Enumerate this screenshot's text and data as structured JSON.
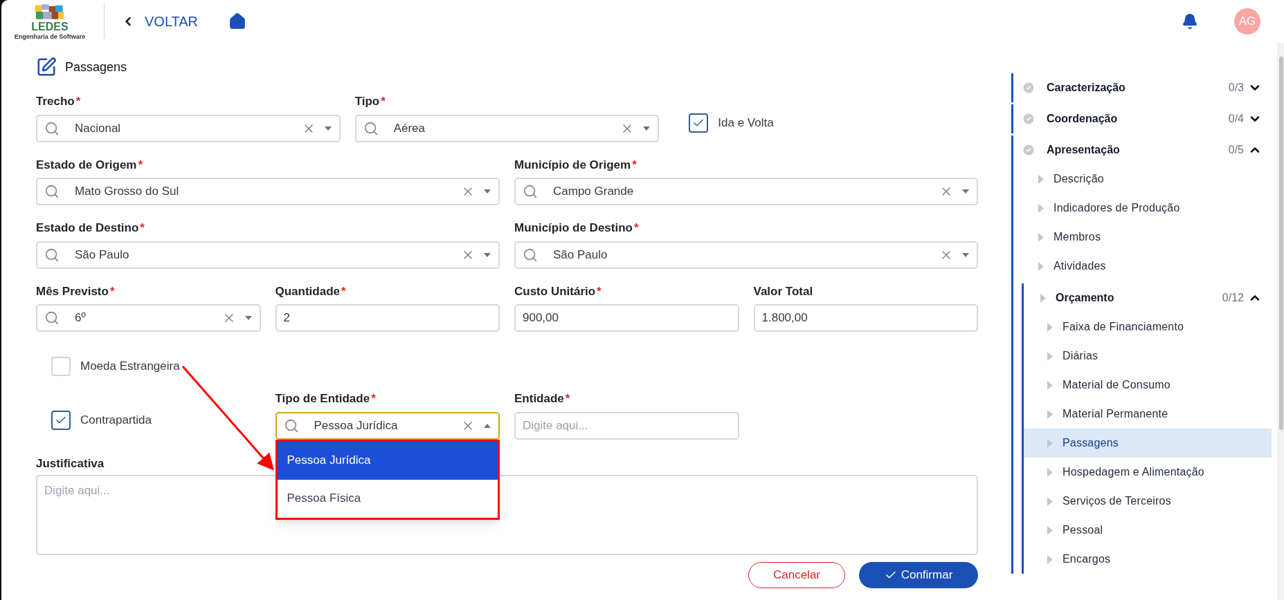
{
  "header": {
    "logo": {
      "title": "LEDES",
      "subtitle": "Engenharia de Software"
    },
    "back_label": "VOLTAR",
    "avatar": "AG"
  },
  "form": {
    "title": "Passagens",
    "rows": [
      {
        "fields": [
          {
            "kind": "select",
            "label": "Trecho",
            "required_mark": "*",
            "value": "Nacional",
            "open": false
          },
          {
            "kind": "select",
            "label": "Tipo",
            "required_mark": "*",
            "value": "Aérea",
            "open": false
          },
          {
            "kind": "checkbox",
            "label": "Ida e Volta",
            "checked": true
          }
        ]
      },
      {
        "fields": [
          {
            "kind": "select",
            "label": "Estado de Origem",
            "required_mark": "*",
            "value": "Mato Grosso do Sul",
            "open": false
          },
          {
            "kind": "select",
            "label": "Município de Origem",
            "required_mark": "*",
            "value": "Campo Grande",
            "open": false
          }
        ]
      },
      {
        "fields": [
          {
            "kind": "select",
            "label": "Estado de Destino",
            "required_mark": "*",
            "value": "São Paulo",
            "open": false
          },
          {
            "kind": "select",
            "label": "Município de Destino",
            "required_mark": "*",
            "value": "São Paulo",
            "open": false
          }
        ]
      },
      {
        "fields": [
          {
            "kind": "select",
            "label": "Mês Previsto",
            "required_mark": "*",
            "value": "6º",
            "open": false
          },
          {
            "kind": "input",
            "label": "Quantidade",
            "required_mark": "*",
            "value": "2"
          },
          {
            "kind": "input",
            "label": "Custo Unitário",
            "required_mark": "*",
            "value": "900,00"
          },
          {
            "kind": "input",
            "label": "Valor Total",
            "value": "1.800,00"
          }
        ]
      },
      {
        "fields": [
          {
            "kind": "checkbox",
            "label": "Moeda Estrangeira",
            "checked": false
          }
        ]
      },
      {
        "fields": [
          {
            "kind": "checkbox",
            "label": "Contrapartida",
            "checked": true
          },
          {
            "kind": "select",
            "label": "Tipo de Entidade",
            "required_mark": "*",
            "value": "Pessoa Jurídica",
            "open": true,
            "options": [
              {
                "label": "Pessoa Jurídica",
                "selected": true
              },
              {
                "label": "Pessoa Física",
                "selected": false
              }
            ]
          },
          {
            "kind": "input",
            "label": "Entidade",
            "required_mark": "*",
            "placeholder": "Digite aqui..."
          }
        ]
      }
    ],
    "justification": {
      "label": "Justificativa",
      "placeholder": "Digite aqui..."
    },
    "buttons": [
      {
        "kind": "cancel",
        "label": "Cancelar"
      },
      {
        "kind": "confirm",
        "label": "Confirmar"
      }
    ]
  },
  "sidebar": {
    "sections": [
      {
        "label": "Caracterização",
        "count": "0/3",
        "expanded": false
      },
      {
        "label": "Coordenação",
        "count": "0/4",
        "expanded": false
      },
      {
        "label": "Apresentação",
        "count": "0/5",
        "expanded": true,
        "children": [
          {
            "label": "Descrição",
            "selected": false
          },
          {
            "label": "Indicadores de Produção",
            "selected": false
          },
          {
            "label": "Membros",
            "selected": false
          },
          {
            "label": "Atividades",
            "selected": false
          },
          {
            "label": "Orçamento",
            "count": "0/12",
            "expanded": true,
            "children": [
              {
                "label": "Faixa de Financiamento",
                "selected": false
              },
              {
                "label": "Diárias",
                "selected": false
              },
              {
                "label": "Material de Consumo",
                "selected": false
              },
              {
                "label": "Material Permanente",
                "selected": false
              },
              {
                "label": "Passagens",
                "selected": true
              },
              {
                "label": "Hospedagem e Alimentação",
                "selected": false
              },
              {
                "label": "Serviços de Terceiros",
                "selected": false
              },
              {
                "label": "Pessoal",
                "selected": false
              },
              {
                "label": "Encargos",
                "selected": false
              }
            ]
          }
        ]
      }
    ]
  }
}
